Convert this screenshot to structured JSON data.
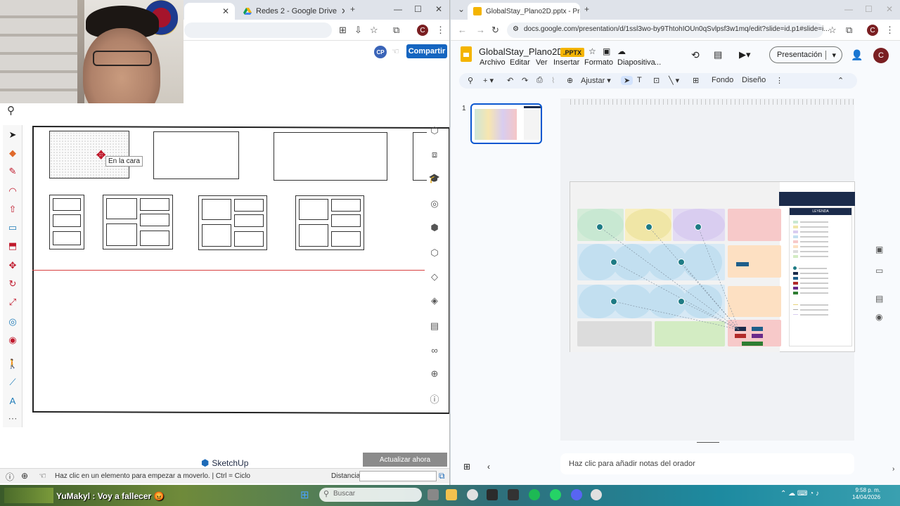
{
  "left_browser": {
    "tabs": [
      {
        "label": "",
        "active": true
      },
      {
        "label": "Redes 2 - Google Drive",
        "active": false
      }
    ],
    "share_button": "Compartir",
    "cp_badge": "CP"
  },
  "sketchup": {
    "tooltip": "En la cara",
    "logo_text": "SketchUp",
    "update_button": "Actualizar ahora",
    "status_text": "Haz clic en un elemento para empezar a moverlo.  |  Ctrl = Ciclo",
    "distance_label": "Distancia",
    "distance_value": ""
  },
  "right_browser": {
    "tab_label": "GlobalStay_Plano2D.pptx - Pres",
    "url": "docs.google.com/presentation/d/1ssl3wo-by9ThtohIOUn0qSvlpsf3w1mq/edit?slide=id.p1#slide=i..."
  },
  "slides": {
    "file_name": "GlobalStay_Plano2D",
    "file_badge": ".PPTX",
    "menus": [
      "Archivo",
      "Editar",
      "Ver",
      "Insertar",
      "Formato",
      "Diapositiva",
      "..."
    ],
    "present_button": "Presentación",
    "toolbar": {
      "zoom": "Ajustar",
      "background": "Fondo",
      "design": "Diseño"
    },
    "slide_number": "1",
    "notes_placeholder": "Haz clic para añadir notas del orador",
    "legend_title": "LEYENDA"
  },
  "taskbar": {
    "chat_message": "YuMakyl : Voy a fallecer 😡",
    "search_placeholder": "Buscar",
    "time": "9:58 p. m.",
    "date": "14/04/2026"
  },
  "colors": {
    "share_blue": "#1565c0",
    "slides_yellow": "#f4b400",
    "selection_blue": "#0b57d0",
    "sketchup_red": "#c0192c"
  }
}
